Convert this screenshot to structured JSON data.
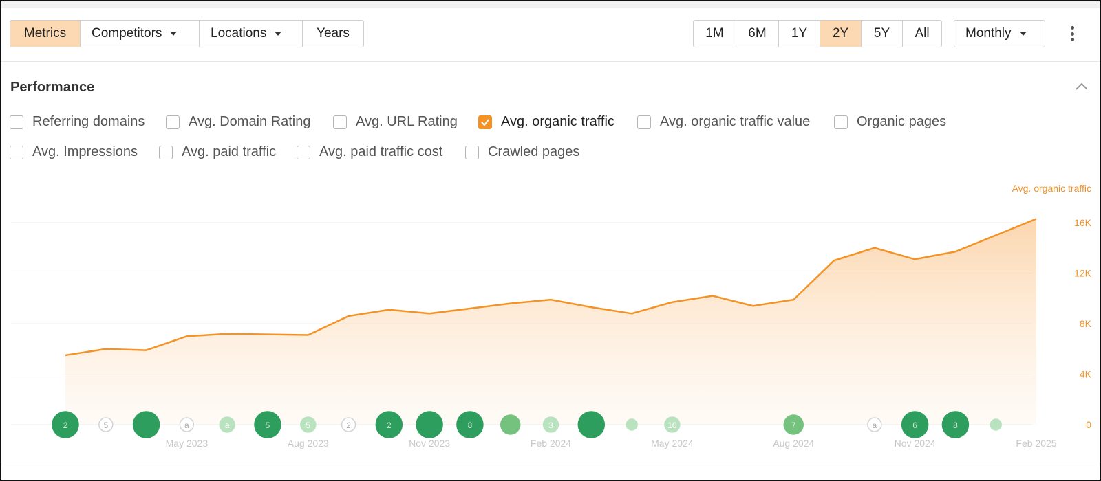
{
  "toolbar": {
    "tabs": [
      {
        "label": "Metrics",
        "active": true,
        "dropdown": false
      },
      {
        "label": "Competitors",
        "active": false,
        "dropdown": true
      },
      {
        "label": "Locations",
        "active": false,
        "dropdown": true
      },
      {
        "label": "Years",
        "active": false,
        "dropdown": false
      }
    ],
    "ranges": [
      {
        "label": "1M",
        "active": false
      },
      {
        "label": "6M",
        "active": false
      },
      {
        "label": "1Y",
        "active": false
      },
      {
        "label": "2Y",
        "active": true
      },
      {
        "label": "5Y",
        "active": false
      },
      {
        "label": "All",
        "active": false
      }
    ],
    "interval": "Monthly",
    "more_icon": "kebab-vertical-icon"
  },
  "section": {
    "title": "Performance",
    "collapse_icon": "chevron-up-icon"
  },
  "metrics": [
    {
      "label": "Referring domains",
      "checked": false
    },
    {
      "label": "Avg. Domain Rating",
      "checked": false
    },
    {
      "label": "Avg. URL Rating",
      "checked": false
    },
    {
      "label": "Avg. organic traffic",
      "checked": true
    },
    {
      "label": "Avg. organic traffic value",
      "checked": false
    },
    {
      "label": "Organic pages",
      "checked": false
    },
    {
      "label": "Avg. Impressions",
      "checked": false
    },
    {
      "label": "Avg. paid traffic",
      "checked": false
    },
    {
      "label": "Avg. paid traffic cost",
      "checked": false
    },
    {
      "label": "Crawled pages",
      "checked": false
    }
  ],
  "colors": {
    "accent": "#f39225",
    "active_bg": "#fcd9b2",
    "axis_text": "#f39225",
    "update_dark": "#2e9e5e",
    "update_light": "#8fd39b"
  },
  "chart_data": {
    "type": "area",
    "series": [
      {
        "name": "Avg. organic traffic",
        "values": [
          5500,
          6000,
          5900,
          7000,
          7200,
          7150,
          7100,
          8600,
          9100,
          8800,
          9200,
          9600,
          9900,
          9300,
          8800,
          9700,
          10200,
          9400,
          9900,
          13000,
          14000,
          13100,
          13700,
          16300
        ]
      }
    ],
    "x": [
      "Feb 2023",
      "Mar 2023",
      "Apr 2023",
      "May 2023",
      "Jun 2023",
      "Jul 2023",
      "Aug 2023",
      "Sep 2023",
      "Oct 2023",
      "Nov 2023",
      "Dec 2023",
      "Jan 2024",
      "Feb 2024",
      "Mar 2024",
      "Apr 2024",
      "May 2024",
      "Jun 2024",
      "Jul 2024",
      "Aug 2024",
      "Sep 2024",
      "Oct 2024",
      "Nov 2024",
      "Dec 2024",
      "Feb 2025"
    ],
    "x_tick_labels": [
      "May 2023",
      "Aug 2023",
      "Nov 2023",
      "Feb 2024",
      "May 2024",
      "Aug 2024",
      "Nov 2024",
      "Feb 2025"
    ],
    "y_axis_label": "Avg. organic traffic",
    "y_tick_labels": [
      "16K",
      "12K",
      "8K",
      "4K",
      "0"
    ],
    "ylim": [
      0,
      16000
    ],
    "grid": true,
    "update_markers": [
      {
        "month": "Feb 2023",
        "kind": "major",
        "label": "2"
      },
      {
        "month": "Mar 2023",
        "kind": "minor",
        "label": "5"
      },
      {
        "month": "Apr 2023",
        "kind": "major",
        "label": ""
      },
      {
        "month": "May 2023",
        "kind": "minor",
        "label": "a"
      },
      {
        "month": "Jun 2023",
        "kind": "light",
        "label": "a"
      },
      {
        "month": "Jul 2023",
        "kind": "major",
        "label": "5"
      },
      {
        "month": "Aug 2023",
        "kind": "light",
        "label": "5"
      },
      {
        "month": "Sep 2023",
        "kind": "minor",
        "label": "2"
      },
      {
        "month": "Oct 2023",
        "kind": "major",
        "label": "2"
      },
      {
        "month": "Nov 2023",
        "kind": "major",
        "label": ""
      },
      {
        "month": "Dec 2023",
        "kind": "major",
        "label": "8"
      },
      {
        "month": "Jan 2024",
        "kind": "medium",
        "label": ""
      },
      {
        "month": "Feb 2024",
        "kind": "light",
        "label": "3"
      },
      {
        "month": "Mar 2024",
        "kind": "major",
        "label": ""
      },
      {
        "month": "Apr 2024",
        "kind": "tiny",
        "label": ""
      },
      {
        "month": "May 2024",
        "kind": "light",
        "label": "10"
      },
      {
        "month": "Aug 2024",
        "kind": "medium",
        "label": "7"
      },
      {
        "month": "Oct 2024",
        "kind": "minor",
        "label": "a"
      },
      {
        "month": "Nov 2024",
        "kind": "major",
        "label": "6"
      },
      {
        "month": "Dec 2024",
        "kind": "major",
        "label": "8"
      },
      {
        "month": "Jan 2025",
        "kind": "tiny",
        "label": ""
      }
    ]
  }
}
